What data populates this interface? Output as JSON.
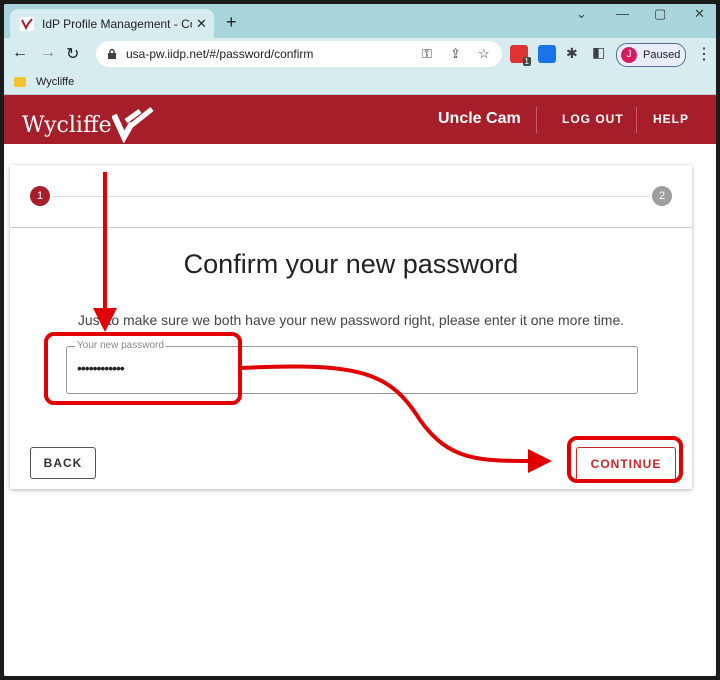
{
  "browser": {
    "tab_title": "IdP Profile Management - Confirm",
    "url": "usa-pw.iidp.net/#/password/confirm",
    "profile_initial": "J",
    "profile_status": "Paused",
    "bookmark_label": "Wycliffe",
    "extension_badge": "1"
  },
  "header": {
    "logo_text": "Wycliffe",
    "user_name": "Uncle Cam",
    "logout_label": "LOG OUT",
    "help_label": "HELP",
    "brand_color": "#a71e2b"
  },
  "stepper": {
    "steps": [
      "1",
      "2"
    ],
    "active_color": "#a71e2b",
    "inactive_color": "#9e9e9e"
  },
  "main": {
    "heading": "Confirm your new password",
    "instructions": "Just to make sure we both have your new password right, please enter it one more time.",
    "password_label": "Your new password",
    "password_value": "••••••••••••",
    "back_label": "BACK",
    "continue_label": "CONTINUE"
  },
  "annotation": {
    "color": "#e00000"
  }
}
